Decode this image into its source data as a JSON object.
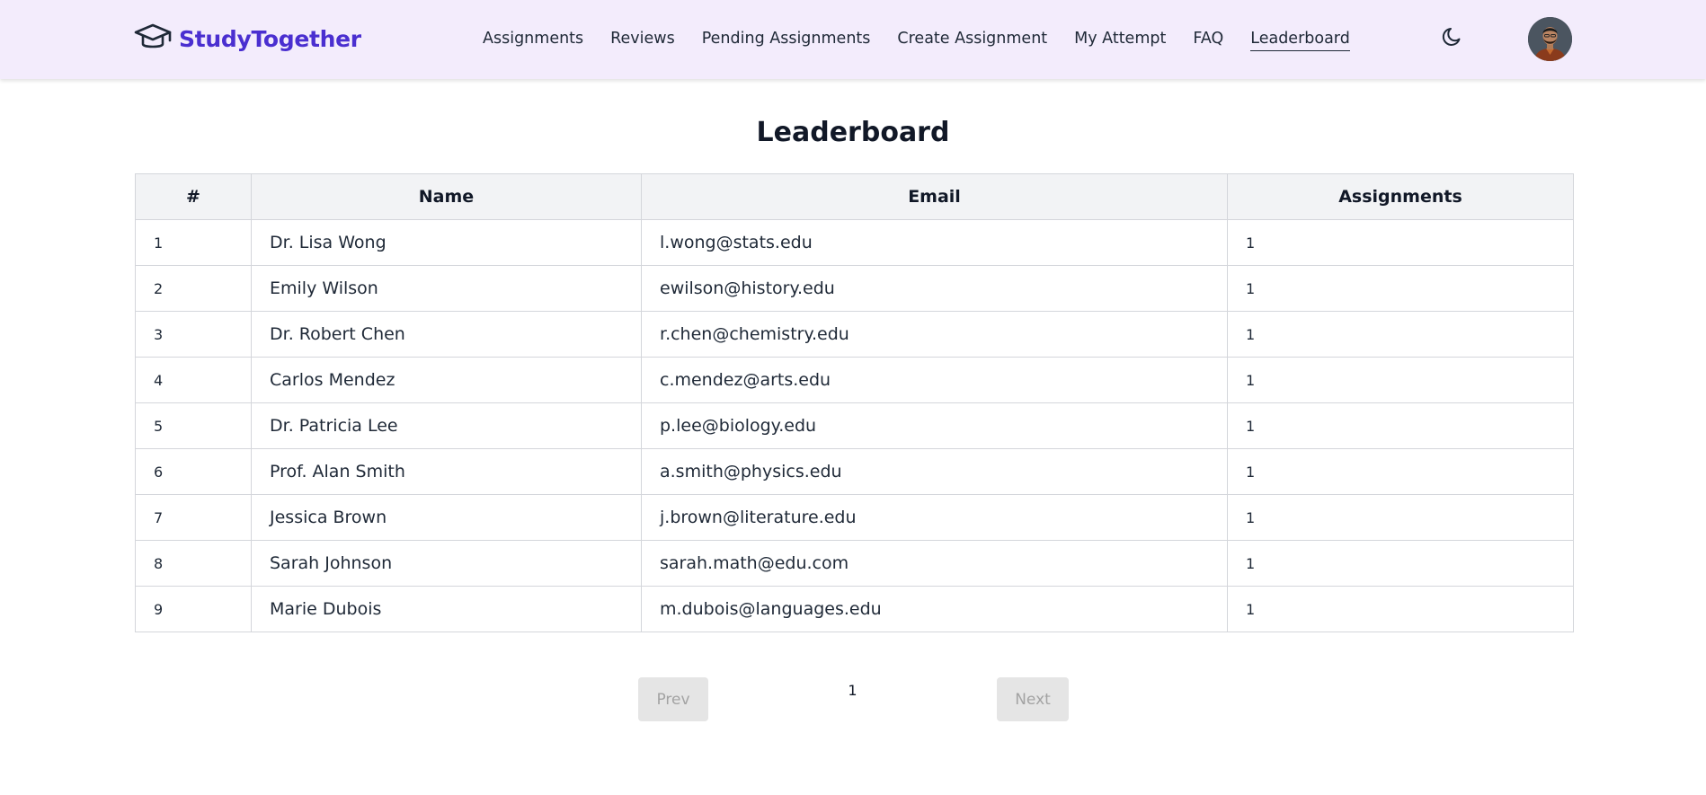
{
  "brand": {
    "name": "StudyTogether",
    "color": "#4a2fd0",
    "icon": "graduation-cap-icon"
  },
  "nav": {
    "links": [
      {
        "label": "Assignments"
      },
      {
        "label": "Reviews"
      },
      {
        "label": "Pending Assignments"
      },
      {
        "label": "Create Assignment"
      },
      {
        "label": "My Attempt"
      },
      {
        "label": "FAQ"
      },
      {
        "label": "Leaderboard",
        "active": true
      }
    ],
    "theme_toggle_icon": "moon-icon",
    "background": "#f3ecfc"
  },
  "page": {
    "title": "Leaderboard"
  },
  "table": {
    "headers": [
      "#",
      "Name",
      "Email",
      "Assignments"
    ],
    "rows": [
      [
        "1",
        "Dr. Lisa Wong",
        "l.wong@stats.edu",
        "1"
      ],
      [
        "2",
        "Emily Wilson",
        "ewilson@history.edu",
        "1"
      ],
      [
        "3",
        "Dr. Robert Chen",
        "r.chen@chemistry.edu",
        "1"
      ],
      [
        "4",
        "Carlos Mendez",
        "c.mendez@arts.edu",
        "1"
      ],
      [
        "5",
        "Dr. Patricia Lee",
        "p.lee@biology.edu",
        "1"
      ],
      [
        "6",
        "Prof. Alan Smith",
        "a.smith@physics.edu",
        "1"
      ],
      [
        "7",
        "Jessica Brown",
        "j.brown@literature.edu",
        "1"
      ],
      [
        "8",
        "Sarah Johnson",
        "sarah.math@edu.com",
        "1"
      ],
      [
        "9",
        "Marie Dubois",
        "m.dubois@languages.edu",
        "1"
      ]
    ]
  },
  "pagination": {
    "prev_label": "Prev",
    "current_page": "1",
    "next_label": "Next"
  }
}
